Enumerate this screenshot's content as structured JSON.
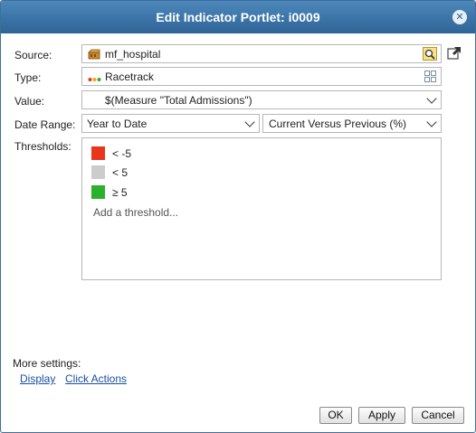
{
  "dialog": {
    "title": "Edit Indicator Portlet: i0009",
    "close_label": "✕"
  },
  "source": {
    "label": "Source:",
    "value": "mf_hospital"
  },
  "type": {
    "label": "Type:",
    "value": "Racetrack"
  },
  "value": {
    "label": "Value:",
    "value": "$(Measure \"Total Admissions\")"
  },
  "date_range": {
    "label": "Date Range:",
    "period": "Year to Date",
    "comparison": "Current Versus Previous (%)"
  },
  "thresholds": {
    "label": "Thresholds:",
    "items": [
      {
        "text": "< -5",
        "color": "#e8351c"
      },
      {
        "text": "< 5",
        "color": "#cccccc"
      },
      {
        "text": "≥ 5",
        "color": "#2bb02b"
      }
    ],
    "add_label": "Add a threshold..."
  },
  "more_settings": {
    "label": "More settings:",
    "display_link": "Display",
    "click_actions_link": "Click Actions"
  },
  "buttons": {
    "ok": "OK",
    "apply": "Apply",
    "cancel": "Cancel"
  }
}
